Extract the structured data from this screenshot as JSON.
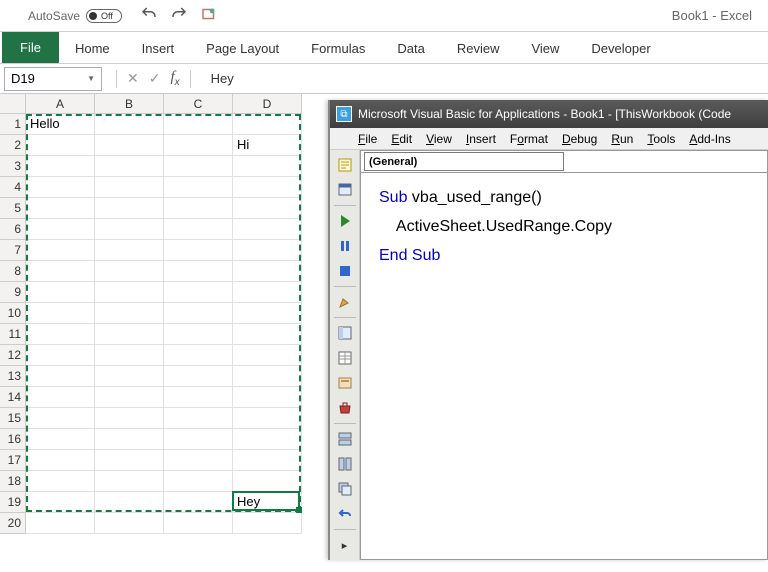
{
  "title": {
    "autosave_label": "AutoSave",
    "autosave_state": "Off",
    "doc": "Book1  -  Excel"
  },
  "ribbon": {
    "file": "File",
    "tabs": [
      "Home",
      "Insert",
      "Page Layout",
      "Formulas",
      "Data",
      "Review",
      "View",
      "Developer"
    ]
  },
  "fxbar": {
    "namebox": "D19",
    "value": "Hey"
  },
  "grid": {
    "cols": [
      "A",
      "B",
      "C",
      "D"
    ],
    "rows": 20,
    "cells": {
      "A1": "Hello",
      "D2": "Hi",
      "D19": "Hey"
    },
    "marquee": {
      "r1": 1,
      "c1": 1,
      "r2": 19,
      "c2": 4
    },
    "active": {
      "r": 19,
      "c": 4
    }
  },
  "vba": {
    "title": "Microsoft Visual Basic for Applications - Book1 - [ThisWorkbook (Code",
    "menu": [
      {
        "l": "F",
        "r": "ile"
      },
      {
        "l": "E",
        "r": "dit"
      },
      {
        "l": "V",
        "r": "iew"
      },
      {
        "l": "I",
        "r": "nsert"
      },
      {
        "l": "",
        "r": "F",
        "o": "o",
        "rm": "rmat"
      },
      {
        "l": "D",
        "r": "ebug"
      },
      {
        "l": "R",
        "r": "un"
      },
      {
        "l": "T",
        "r": "ools"
      },
      {
        "l": "A",
        "r": "dd-Ins"
      }
    ],
    "object_dropdown": "(General)",
    "code": {
      "l1": {
        "kw1": "Sub",
        "name": " vba_used_range()"
      },
      "l2": "    ActiveSheet.UsedRange.Copy",
      "l3": {
        "kw1": "End",
        "kw2": " Sub"
      }
    }
  }
}
